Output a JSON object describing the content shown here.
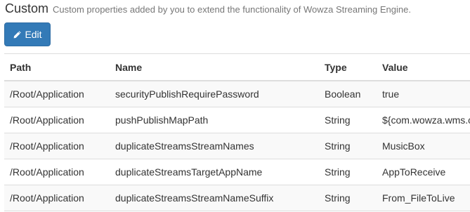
{
  "section": {
    "title": "Custom",
    "description": "Custom properties added by you to extend the functionality of Wowza Streaming Engine."
  },
  "edit_button": {
    "label": "Edit",
    "icon": "pencil-icon",
    "color": "#337ab7"
  },
  "table": {
    "headers": {
      "path": "Path",
      "name": "Name",
      "type": "Type",
      "value": "Value"
    },
    "rows": [
      {
        "path": "/Root/Application",
        "name": "securityPublishRequirePassword",
        "type": "Boolean",
        "value": "true"
      },
      {
        "path": "/Root/Application",
        "name": "pushPublishMapPath",
        "type": "String",
        "value": "${com.wowza.wms.c"
      },
      {
        "path": "/Root/Application",
        "name": "duplicateStreamsStreamNames",
        "type": "String",
        "value": "MusicBox"
      },
      {
        "path": "/Root/Application",
        "name": "duplicateStreamsTargetAppName",
        "type": "String",
        "value": "AppToReceive"
      },
      {
        "path": "/Root/Application",
        "name": "duplicateStreamsStreamNameSuffix",
        "type": "String",
        "value": "From_FileToLive"
      }
    ]
  }
}
